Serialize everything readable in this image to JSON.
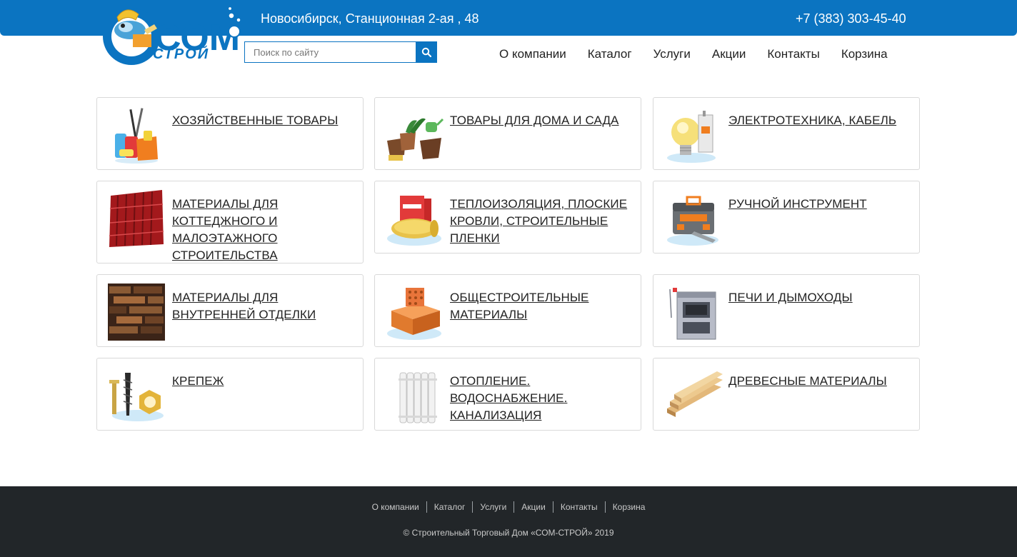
{
  "header": {
    "address": "Новосибирск, Станционная 2-ая , 48",
    "phone": "+7 (383) 303-45-40",
    "logo": {
      "text_main": "СОМ",
      "text_sub": "СТРОЙ"
    },
    "search": {
      "placeholder": "Поиск по сайту",
      "icon": "search-icon"
    },
    "nav": [
      {
        "label": "О компании"
      },
      {
        "label": "Каталог"
      },
      {
        "label": "Услуги"
      },
      {
        "label": "Акции"
      },
      {
        "label": "Контакты"
      },
      {
        "label": "Корзина"
      }
    ]
  },
  "catalog": [
    {
      "title": "ХОЗЯЙСТВЕННЫЕ ТОВАРЫ",
      "icon": "household-goods-icon"
    },
    {
      "title": "ТОВАРЫ ДЛЯ ДОМА И САДА",
      "icon": "garden-pots-icon"
    },
    {
      "title": "ЭЛЕКТРОТЕХНИКА, КАБЕЛЬ",
      "icon": "lightbulb-icon"
    },
    {
      "title": "МАТЕРИАЛЫ ДЛЯ КОТТЕДЖНОГО И МАЛОЭТАЖНОГО СТРОИТЕЛЬСТВА",
      "icon": "metal-roof-icon"
    },
    {
      "title": "ТЕПЛОИЗОЛЯЦИЯ, ПЛОСКИЕ КРОВЛИ, СТРОИТЕЛЬНЫЕ ПЛЕНКИ",
      "icon": "insulation-roll-icon"
    },
    {
      "title": "РУЧНОЙ ИНСТРУМЕНТ",
      "icon": "toolbox-icon"
    },
    {
      "title": "МАТЕРИАЛЫ ДЛЯ ВНУТРЕННЕЙ ОТДЕЛКИ",
      "icon": "wood-panels-icon"
    },
    {
      "title": "ОБЩЕСТРОИТЕЛЬНЫЕ МАТЕРИАЛЫ",
      "icon": "brick-icon"
    },
    {
      "title": "ПЕЧИ И ДЫМОХОДЫ",
      "icon": "stove-icon"
    },
    {
      "title": "КРЕПЕЖ",
      "icon": "fasteners-icon"
    },
    {
      "title": "ОТОПЛЕНИЕ. ВОДОСНАБЖЕНИЕ. КАНАЛИЗАЦИЯ",
      "icon": "radiator-icon"
    },
    {
      "title": "ДРЕВЕСНЫЕ МАТЕРИАЛЫ",
      "icon": "lumber-icon"
    }
  ],
  "footer": {
    "nav": [
      {
        "label": "О компании"
      },
      {
        "label": "Каталог"
      },
      {
        "label": "Услуги"
      },
      {
        "label": "Акции"
      },
      {
        "label": "Контакты"
      },
      {
        "label": "Корзина"
      }
    ],
    "copyright": "© Строительный Торговый Дом «СОМ-СТРОЙ» 2019"
  },
  "colors": {
    "brand_blue": "#0b74c1",
    "footer_bg": "#222629",
    "card_border": "#d9d9d9"
  }
}
